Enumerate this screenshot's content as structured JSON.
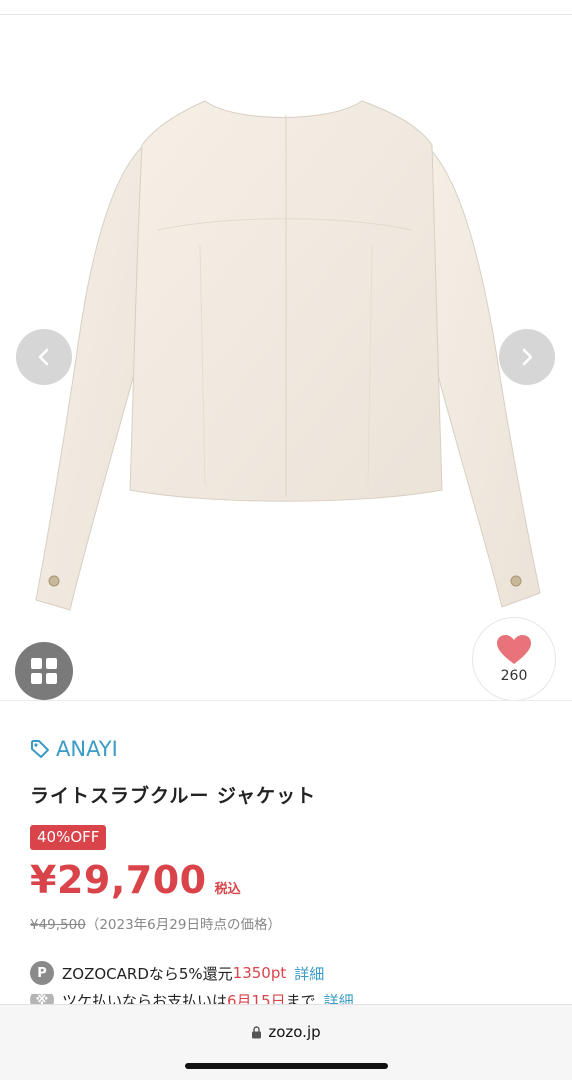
{
  "gallery": {
    "prev_icon": "chevron-left-icon",
    "next_icon": "chevron-right-icon",
    "grid_icon": "grid-icon",
    "favorite_icon": "heart-icon",
    "favorite_count": "260"
  },
  "product": {
    "brand": "ANAYI",
    "brand_icon": "tag-icon",
    "title": "ライトスラブクルー ジャケット",
    "discount_badge": "40%OFF",
    "price": "¥29,700",
    "tax_label": "税込",
    "original_price": "¥49,500",
    "original_note": "（2023年6月29日時点の価格）"
  },
  "points": {
    "icon_label": "P",
    "text_prefix": "ZOZOCARDなら5%還元",
    "points_value": "1350pt",
    "detail_link": "詳細"
  },
  "second_row": {
    "icon_label": "※",
    "text_prefix": "ツケ払いならお支払いは",
    "date_value": "6月15日",
    "text_suffix": "まで",
    "detail_link": "詳細"
  },
  "browser": {
    "url": "zozo.jp",
    "lock_icon": "lock-icon"
  },
  "colors": {
    "accent_red": "#d9434a",
    "link_blue": "#3a9bc6",
    "heart_pink": "#e8737a"
  }
}
